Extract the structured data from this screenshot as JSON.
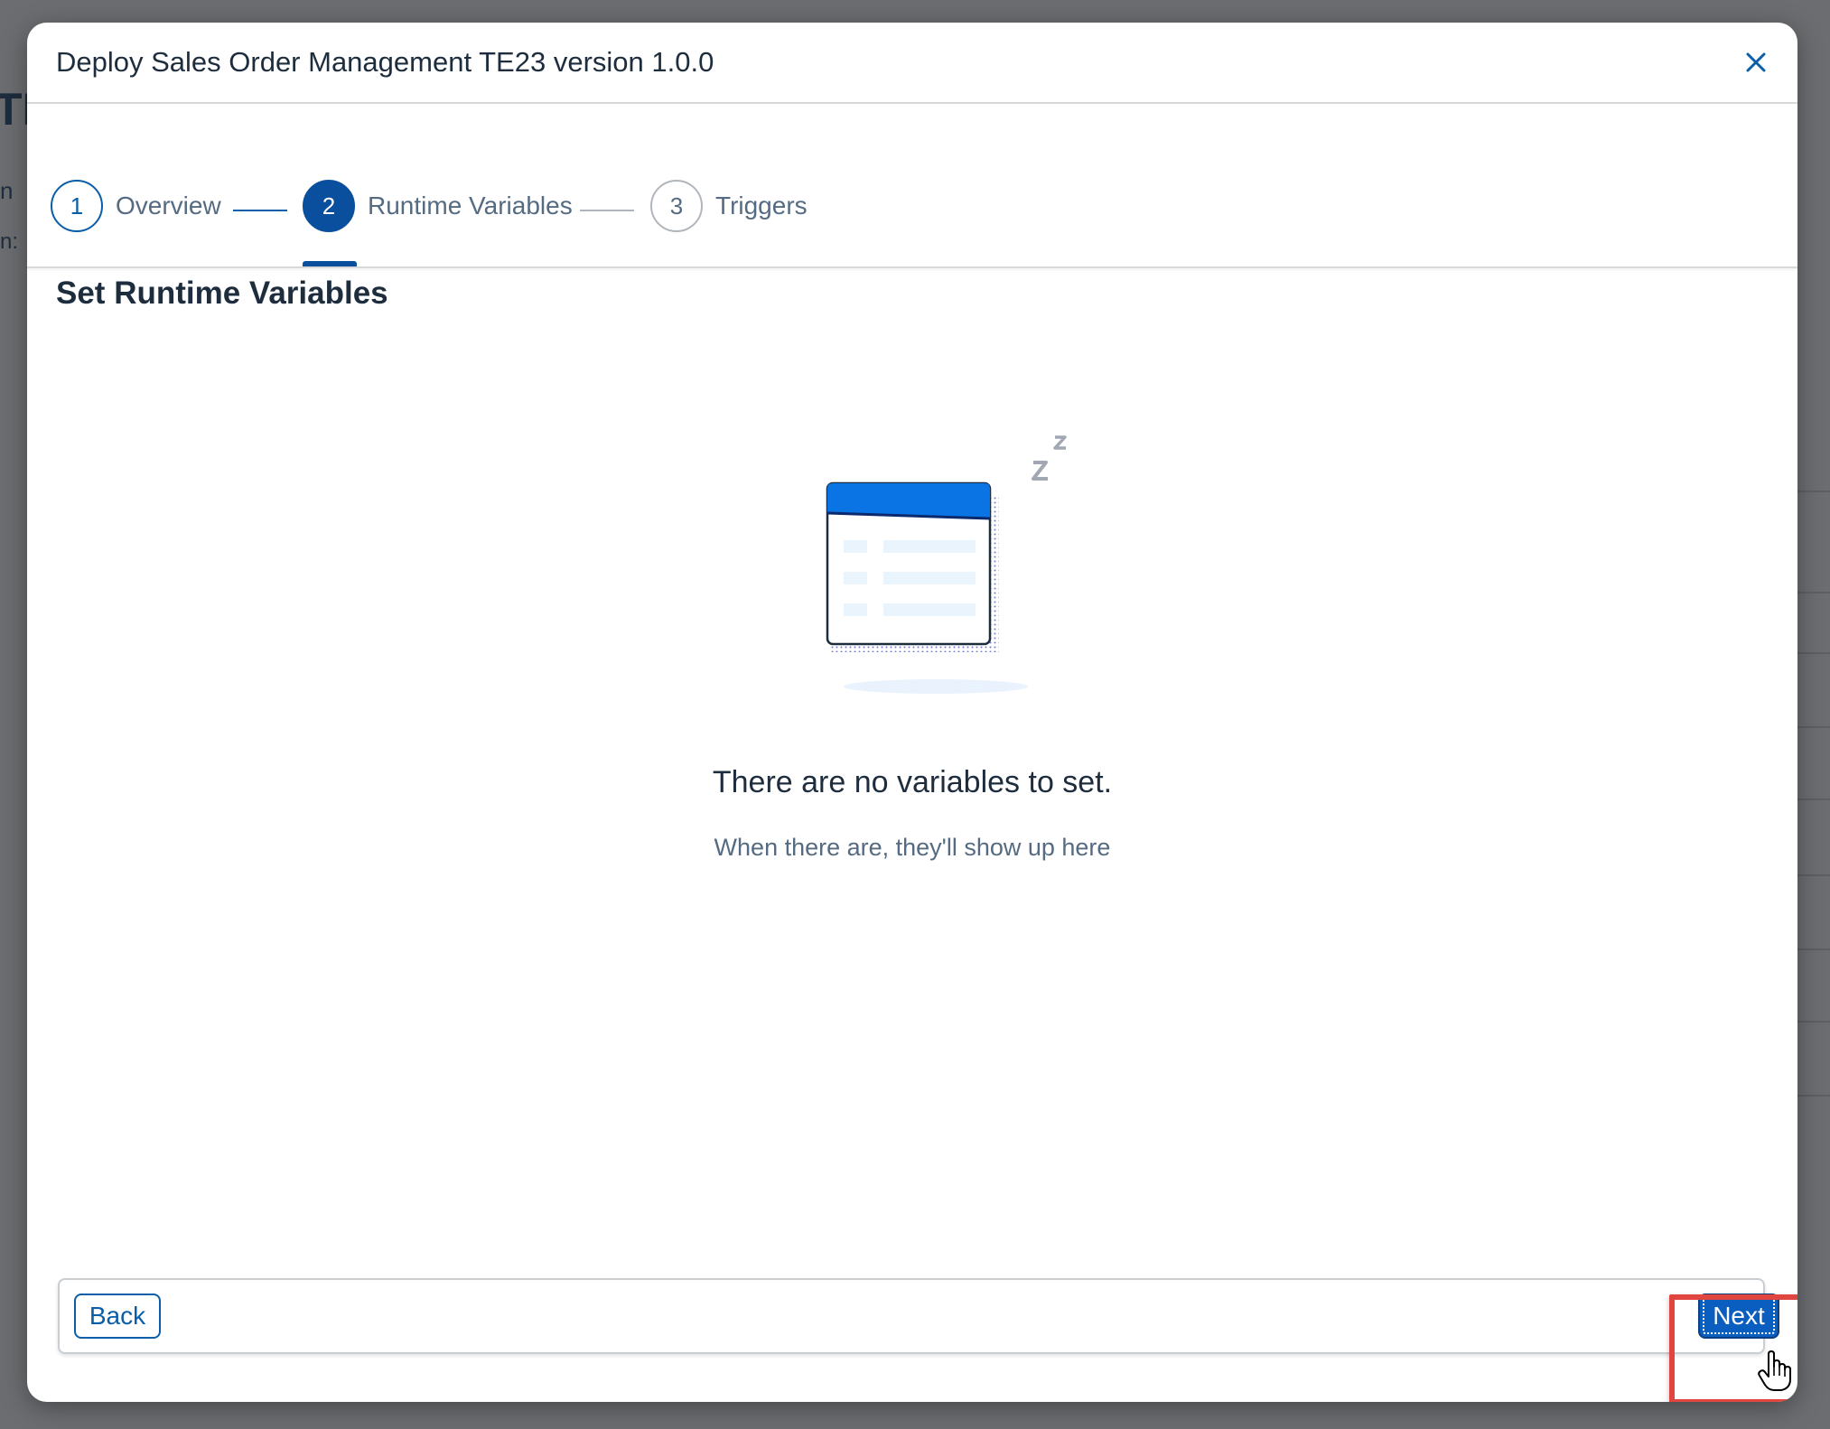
{
  "dialog": {
    "title": "Deploy Sales Order Management TE23 version 1.0.0",
    "close_icon": "close-icon"
  },
  "wizard": {
    "steps": [
      {
        "number": "1",
        "label": "Overview",
        "state": "completed"
      },
      {
        "number": "2",
        "label": "Runtime Variables",
        "state": "active"
      },
      {
        "number": "3",
        "label": "Triggers",
        "state": "upcoming"
      }
    ]
  },
  "content": {
    "section_title": "Set Runtime Variables",
    "illustration_icon": "empty-table-sleeping-icon",
    "empty_title": "There are no variables to set.",
    "empty_subtitle": "When there are, they'll show up here"
  },
  "footer": {
    "back_label": "Back",
    "next_label": "Next"
  },
  "background": {
    "fragment_1": "TE",
    "fragment_2": "n",
    "fragment_3": "n:"
  },
  "colors": {
    "accent": "#0a5ea8",
    "active_step": "#0a4f9e",
    "highlight": "#e0453f",
    "overlay": "#646668"
  }
}
